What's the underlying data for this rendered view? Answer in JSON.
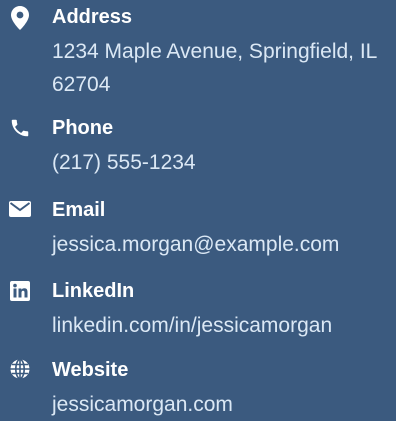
{
  "contact": {
    "accent_color": "#3b5a7f",
    "label_color": "#ffffff",
    "value_color": "#dbe8f5",
    "items": [
      {
        "icon": "location-pin-icon",
        "label": "Address",
        "value": "1234 Maple Avenue, Springfield, IL 62704"
      },
      {
        "icon": "phone-icon",
        "label": "Phone",
        "value": "(217) 555-1234"
      },
      {
        "icon": "email-icon",
        "label": "Email",
        "value": "jessica.morgan@example.com"
      },
      {
        "icon": "linkedin-icon",
        "label": "LinkedIn",
        "value": "linkedin.com/in/jessicamorgan"
      },
      {
        "icon": "globe-icon",
        "label": "Website",
        "value": "jessicamorgan.com"
      }
    ]
  }
}
